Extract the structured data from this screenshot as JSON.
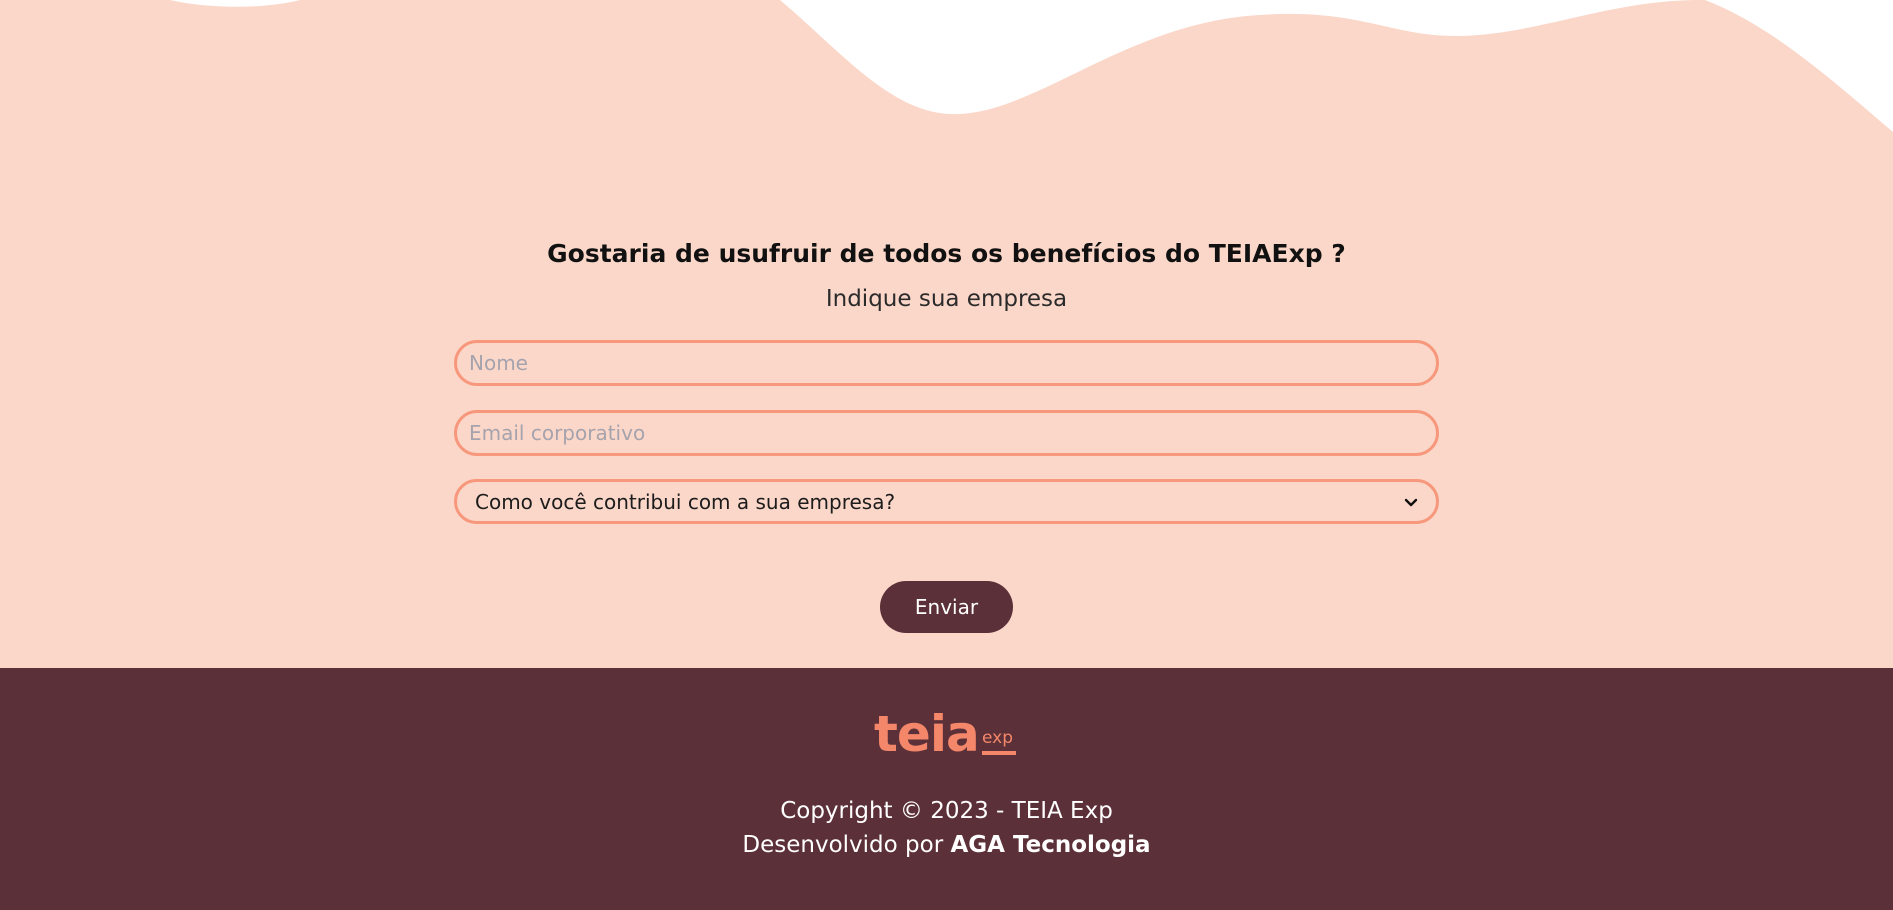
{
  "colors": {
    "hero_background": "#fbd7c9",
    "field_border": "#f7987d",
    "footer_background": "#5c3038",
    "button_background": "#5c3038",
    "logo": "#f4866a"
  },
  "form": {
    "title": "Gostaria de usufruir de todos os benefícios do TEIAExp ?",
    "subtitle": "Indique sua empresa",
    "name_placeholder": "Nome",
    "email_placeholder": "Email corporativo",
    "select_value": "Como você contribui com a sua empresa?",
    "select_icon": "chevron-down-icon",
    "submit_label": "Enviar"
  },
  "footer": {
    "logo_main": "teia",
    "logo_sub": "exp",
    "copyright": "Copyright © 2023 - TEIA Exp",
    "developer_prefix": "Desenvolvido por",
    "developer_name": "AGA Tecnologia"
  }
}
